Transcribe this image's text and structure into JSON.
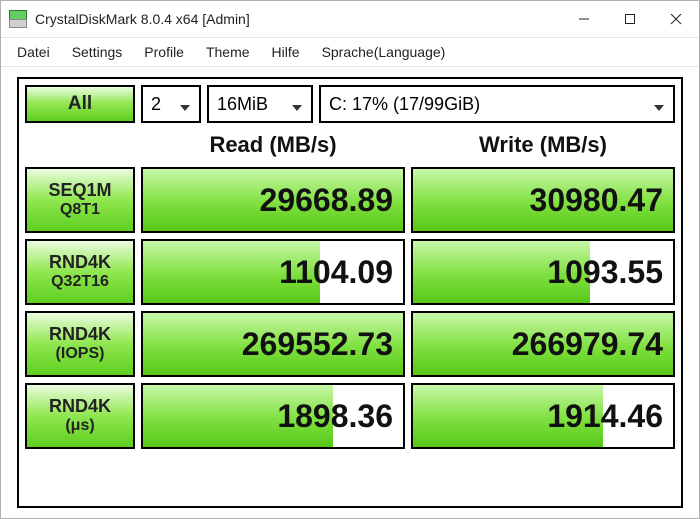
{
  "title": "CrystalDiskMark 8.0.4 x64 [Admin]",
  "menu": [
    "Datei",
    "Settings",
    "Profile",
    "Theme",
    "Hilfe",
    "Sprache(Language)"
  ],
  "buttons": {
    "all": "All"
  },
  "selects": {
    "runs": "2",
    "size": "16MiB",
    "drive": "C: 17% (17/99GiB)"
  },
  "headers": {
    "read": "Read (MB/s)",
    "write": "Write (MB/s)"
  },
  "tests": [
    {
      "line1": "SEQ1M",
      "line2": "Q8T1",
      "read": {
        "value": "29668.89",
        "bar": "width:100%"
      },
      "write": {
        "value": "30980.47",
        "bar": "width:100%"
      }
    },
    {
      "line1": "RND4K",
      "line2": "Q32T16",
      "read": {
        "value": "1104.09",
        "bar": "width:68%"
      },
      "write": {
        "value": "1093.55",
        "bar": "width:68%"
      }
    },
    {
      "line1": "RND4K",
      "line2": "(IOPS)",
      "read": {
        "value": "269552.73",
        "bar": "width:100%"
      },
      "write": {
        "value": "266979.74",
        "bar": "width:100%"
      }
    },
    {
      "line1": "RND4K",
      "line2": "(μs)",
      "read": {
        "value": "1898.36",
        "bar": "width:73%"
      },
      "write": {
        "value": "1914.46",
        "bar": "width:73%"
      }
    }
  ]
}
